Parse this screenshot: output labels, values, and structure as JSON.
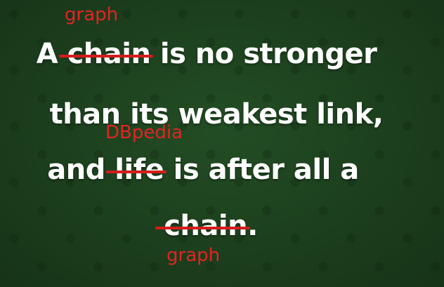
{
  "quote": {
    "line1": {
      "before": "A ",
      "struck": "chain",
      "after": " is no stronger"
    },
    "line2": {
      "text": "than its weakest link,"
    },
    "line3": {
      "before": "and ",
      "struck": "life",
      "after": " is after all a"
    },
    "line4": {
      "before": "",
      "struck": "chain",
      "after": "."
    }
  },
  "replacements": {
    "first": "graph",
    "second": "DBpedia",
    "third": "graph"
  },
  "colors": {
    "background": "#1f4520",
    "quote_text": "#ffffff",
    "correction": "#e32424"
  }
}
